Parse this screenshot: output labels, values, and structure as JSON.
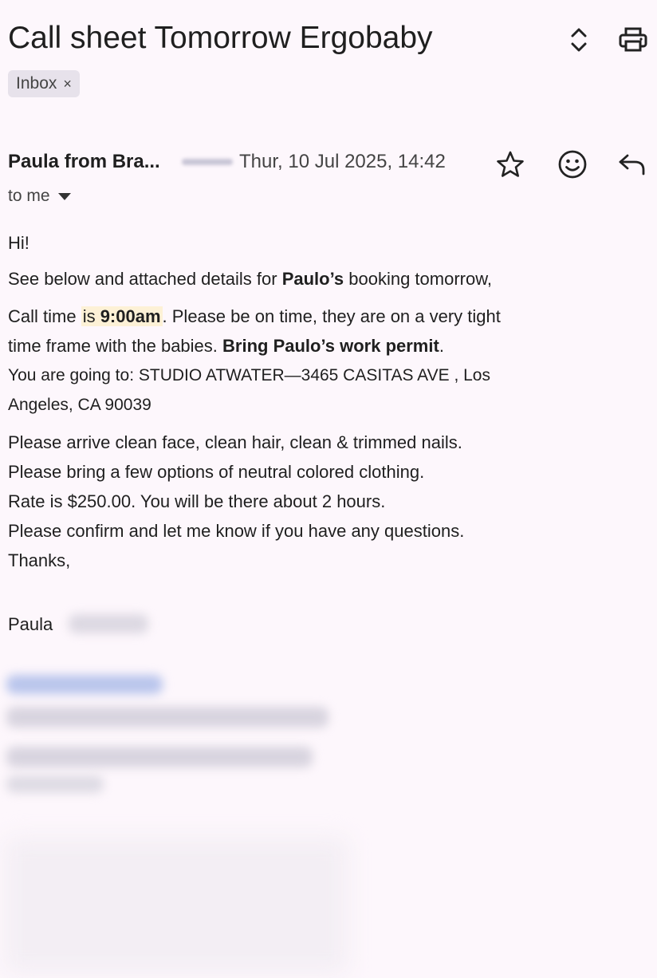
{
  "subject": "Call sheet Tomorrow Ergobaby",
  "label_chip": {
    "text": "Inbox",
    "remove": "×"
  },
  "message": {
    "sender": "Paula from Bra...",
    "date": "Thur, 10 Jul 2025, 14:42",
    "recipient": "to me"
  },
  "body": {
    "greeting": "Hi!",
    "line1_pre": "See below and attached details for ",
    "line1_bold": "Paulo’s",
    "line1_post": " booking tomorrow,",
    "line2_pre": "Call time ",
    "line2_is": "is ",
    "line2_time": "9:00am",
    "line2_post": ".  Please be on time, they are on a very tight",
    "line3_pre": "time frame with the babies. ",
    "line3_bold": "Bring Paulo’s work permit",
    "line3_post": ".",
    "address_line1": "You are going to: STUDIO ATWATER—3465 CASITAS AVE , Los",
    "address_line2": "Angeles, CA 90039",
    "instr1": "Please arrive clean face, clean hair, clean & trimmed nails.",
    "instr2": "Please bring a few options of neutral colored clothing.",
    "rate": "Rate is $250.00. You will be there about 2 hours.",
    "confirm": "Please confirm and let me know if you have any questions.",
    "thanks": "Thanks,",
    "signature": "Paula"
  },
  "icons": {
    "expand": "chevrons-up-down-icon",
    "print": "printer-icon",
    "star": "star-icon",
    "emoji": "emoji-icon",
    "reply": "reply-icon"
  }
}
